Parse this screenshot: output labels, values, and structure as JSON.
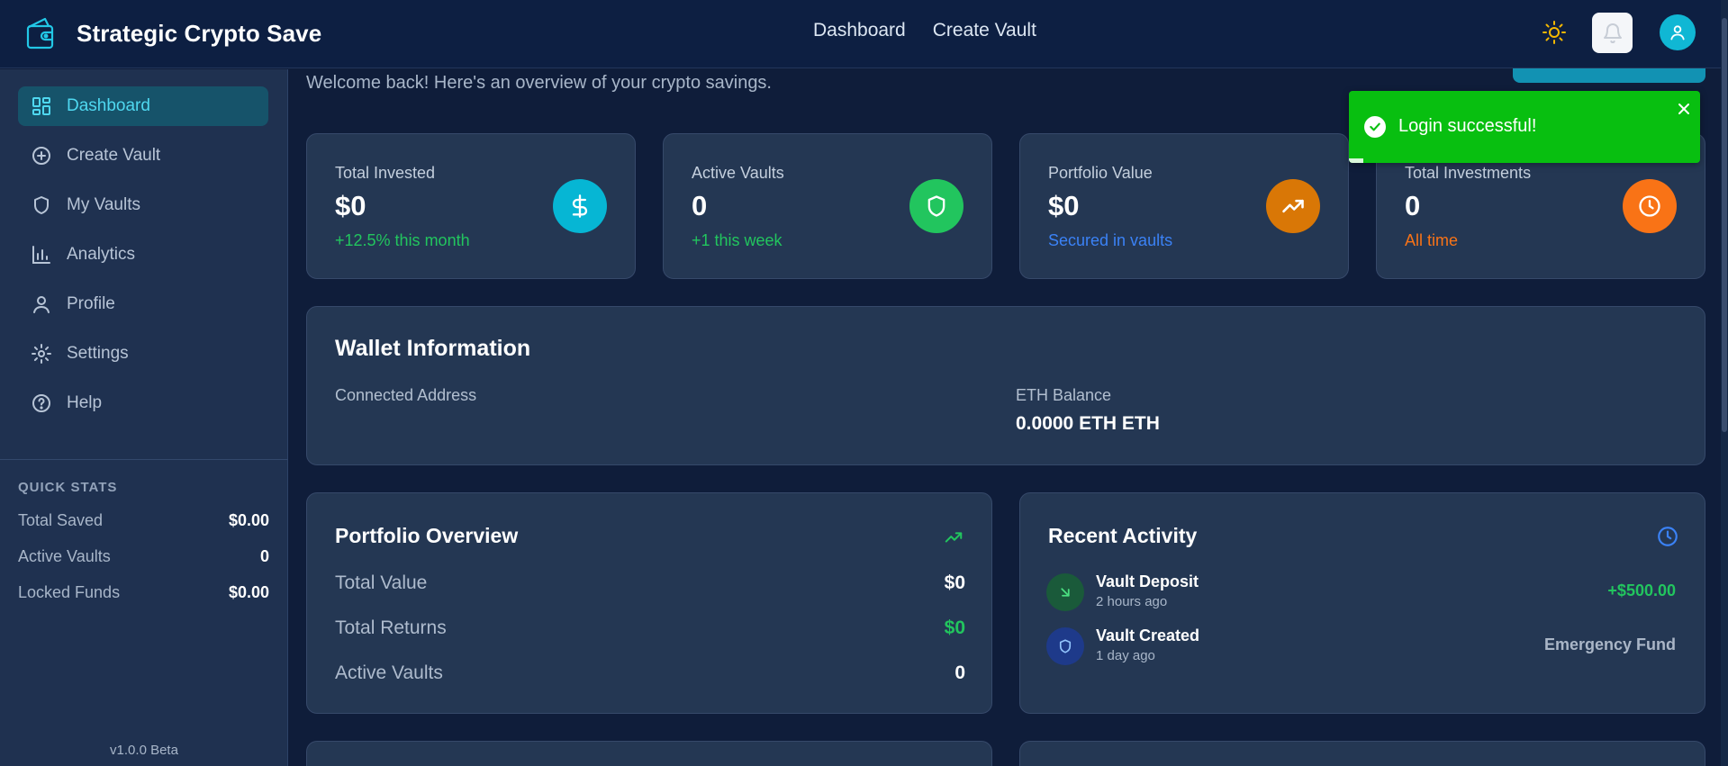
{
  "app": {
    "title": "Strategic Crypto Save"
  },
  "header": {
    "nav": [
      {
        "label": "Dashboard",
        "icon": ""
      },
      {
        "label": "Create Vault",
        "icon": ""
      }
    ],
    "icons": {
      "theme": "sun-icon",
      "notifications": "bell-icon",
      "user": "user-icon"
    }
  },
  "sidebar": {
    "items": [
      {
        "label": "Dashboard",
        "icon": "dashboard-grid-icon",
        "active": true
      },
      {
        "label": "Create Vault",
        "icon": "plus-circle-icon"
      },
      {
        "label": "My Vaults",
        "icon": "shield-icon"
      },
      {
        "label": "Analytics",
        "icon": "bar-chart-icon"
      },
      {
        "label": "Profile",
        "icon": "user-icon"
      },
      {
        "label": "Settings",
        "icon": "gear-icon"
      },
      {
        "label": "Help",
        "icon": "help-circle-icon"
      }
    ],
    "quick_stats": {
      "heading": "QUICK STATS",
      "rows": [
        {
          "label": "Total Saved",
          "value": "$0.00"
        },
        {
          "label": "Active Vaults",
          "value": "0"
        },
        {
          "label": "Locked Funds",
          "value": "$0.00"
        }
      ]
    },
    "version": "v1.0.0 Beta"
  },
  "main": {
    "welcome": "Welcome back! Here's an overview of your crypto savings.",
    "stats": [
      {
        "label": "Total Invested",
        "value": "$0",
        "sub": "+12.5% this month",
        "sub_color": "#22c55e",
        "icon": "dollar-icon",
        "icon_bg": "#06b6d4"
      },
      {
        "label": "Active Vaults",
        "value": "0",
        "sub": "+1 this week",
        "sub_color": "#22c55e",
        "icon": "shield-icon",
        "icon_bg": "#22c55e"
      },
      {
        "label": "Portfolio Value",
        "value": "$0",
        "sub": "Secured in vaults",
        "sub_color": "#3b82f6",
        "icon": "trending-up-icon",
        "icon_bg": "#d97706"
      },
      {
        "label": "Total Investments",
        "value": "0",
        "sub": "All time",
        "sub_color": "#f97316",
        "icon": "clock-icon",
        "icon_bg": "#f97316"
      }
    ],
    "wallet": {
      "title": "Wallet Information",
      "address_label": "Connected Address",
      "address_value": "",
      "balance_label": "ETH Balance",
      "balance_value": "0.0000 ETH ETH"
    },
    "portfolio": {
      "title": "Portfolio Overview",
      "icon": "trending-up-icon",
      "rows": [
        {
          "label": "Total Value",
          "value": "$0",
          "color": "#ffffff"
        },
        {
          "label": "Total Returns",
          "value": "$0",
          "color": "#22c55e"
        },
        {
          "label": "Active Vaults",
          "value": "0",
          "color": "#ffffff"
        }
      ]
    },
    "activity": {
      "title": "Recent Activity",
      "icon": "clock-icon",
      "items": [
        {
          "title": "Vault Deposit",
          "time": "2 hours ago",
          "amount": "+$500.00",
          "amount_color": "#22c55e",
          "icon": "arrow-down-right-icon"
        },
        {
          "title": "Vault Created",
          "time": "1 day ago",
          "amount": "Emergency Fund",
          "amount_color": "#aab6c7",
          "icon": "shield-icon"
        }
      ]
    }
  },
  "toast": {
    "message": "Login successful!",
    "progress": 0.04
  },
  "colors": {
    "accent": "#06b6d4",
    "success": "#22c55e",
    "toast": "#08bf10"
  }
}
